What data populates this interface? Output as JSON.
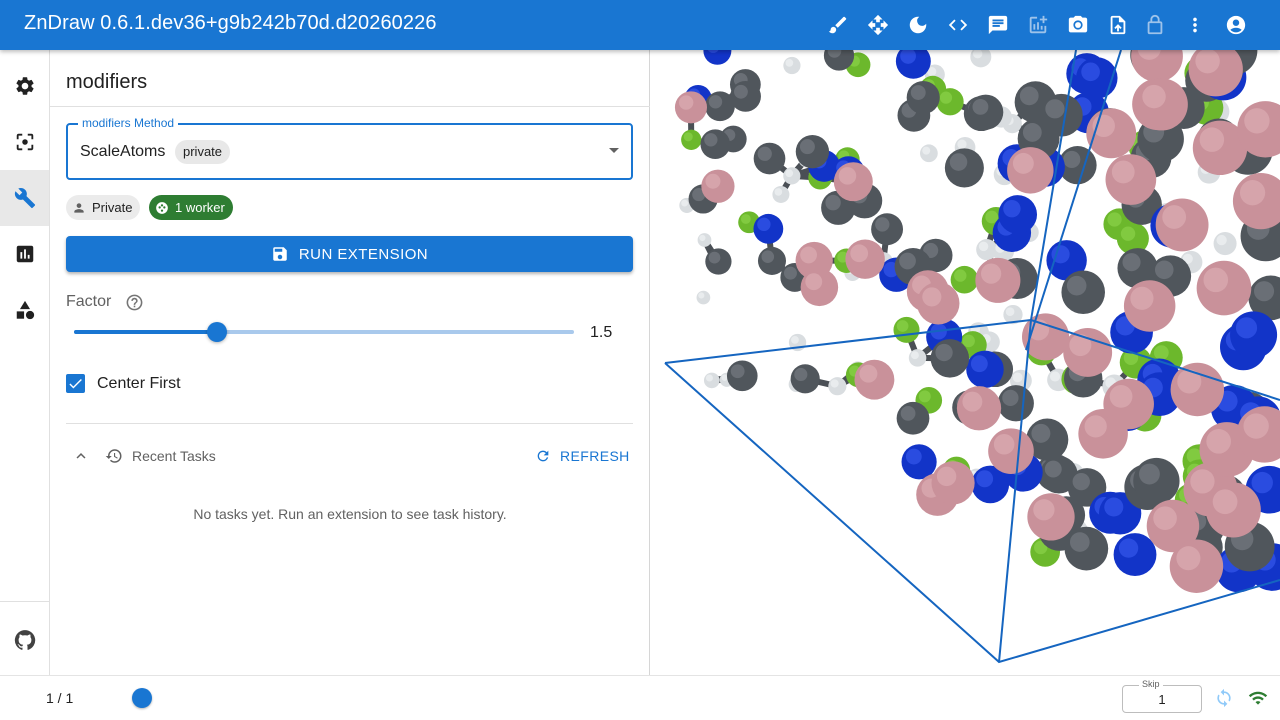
{
  "app": {
    "title": "ZnDraw 0.6.1.dev36+g9b242b70d.d20260226",
    "accent_color": "#1976d2"
  },
  "toolbar": {
    "icons": [
      "brush-icon",
      "move-icon",
      "dark-mode-icon",
      "code-icon",
      "chat-icon",
      "add-chart-icon",
      "camera-icon",
      "upload-icon",
      "lock-icon",
      "more-vert-icon",
      "account-icon"
    ]
  },
  "rail": {
    "items": [
      "settings-icon",
      "selection-icon",
      "modifiers-icon",
      "analysis-icon",
      "geometry-icon"
    ],
    "active": "modifiers-icon",
    "footer_icon": "github-icon"
  },
  "panel": {
    "title": "modifiers",
    "method_select": {
      "legend": "modifiers Method",
      "value": "ScaleAtoms",
      "tag": "private"
    },
    "chips": {
      "private_label": "Private",
      "worker_label": "1 worker",
      "worker_color": "#2e7d32"
    },
    "run_button_label": "RUN EXTENSION",
    "factor": {
      "label": "Factor",
      "value": "1.5",
      "fraction": 0.286
    },
    "center_first": {
      "label": "Center First",
      "checked": true
    },
    "recent_tasks": {
      "label": "Recent Tasks",
      "refresh_label": "REFRESH",
      "empty_message": "No tasks yet. Run an extension to see task history."
    }
  },
  "bottom": {
    "frame_counter": "1 / 1",
    "skip_label": "Skip",
    "skip_value": "1"
  }
}
